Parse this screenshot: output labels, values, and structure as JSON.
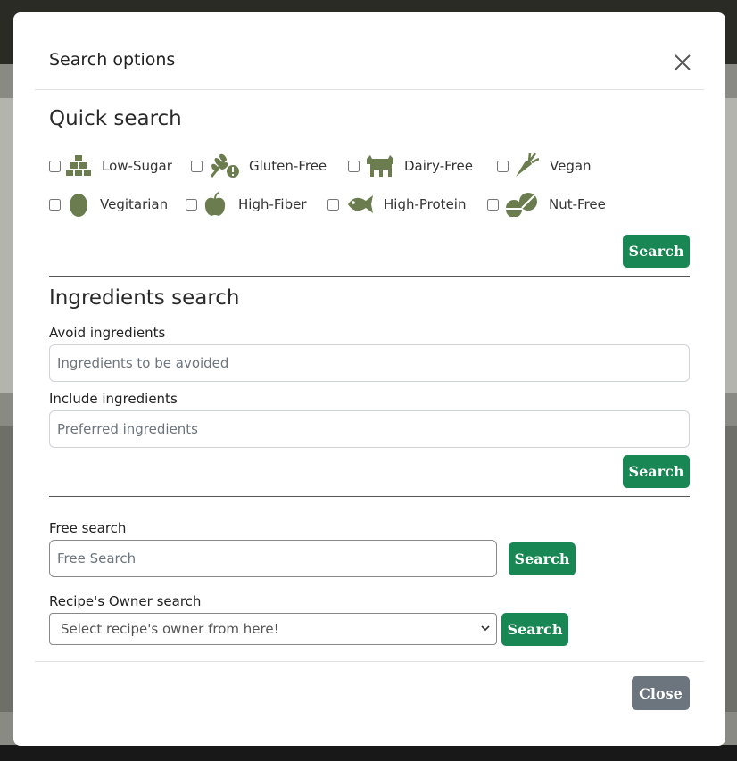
{
  "modal": {
    "title": "Search options",
    "close_label": "Close"
  },
  "quick_search": {
    "heading": "Quick search",
    "items": [
      {
        "label": "Low-Sugar",
        "icon": "sugar-cubes-icon"
      },
      {
        "label": "Gluten-Free",
        "icon": "wheat-warning-icon"
      },
      {
        "label": "Dairy-Free",
        "icon": "cow-icon"
      },
      {
        "label": "Vegan",
        "icon": "carrot-icon"
      },
      {
        "label": "Vegitarian",
        "icon": "egg-icon"
      },
      {
        "label": "High-Fiber",
        "icon": "apple-icon"
      },
      {
        "label": "High-Protein",
        "icon": "fish-icon"
      },
      {
        "label": "Nut-Free",
        "icon": "pill-icon"
      }
    ],
    "search_label": "Search"
  },
  "ingredients_search": {
    "heading": "Ingredients search",
    "avoid_label": "Avoid ingredients",
    "avoid_placeholder": "Ingredients to be avoided",
    "include_label": "Include ingredients",
    "include_placeholder": "Preferred ingredients",
    "search_label": "Search"
  },
  "free_search": {
    "label": "Free search",
    "placeholder": "Free Search",
    "search_label": "Search"
  },
  "owner_search": {
    "label": "Recipe's Owner search",
    "selected": "Select recipe's owner from here!",
    "search_label": "Search"
  },
  "colors": {
    "accent": "#198754",
    "icon": "#6b7d4f",
    "secondary": "#6c757d"
  }
}
